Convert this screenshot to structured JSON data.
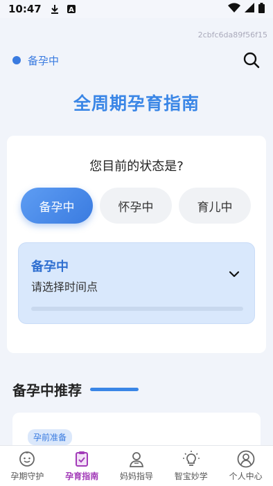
{
  "status_bar": {
    "time": "10:47",
    "icons": [
      "download-icon",
      "notification-a-icon",
      "wifi-icon",
      "signal-icon",
      "battery-icon"
    ]
  },
  "session_id": "2cbfc6da89f56f15",
  "topbar": {
    "state_label": "备孕中",
    "search_icon": "search-icon"
  },
  "hero": {
    "title": "全周期孕育指南"
  },
  "status_card": {
    "question": "您目前的状态是?",
    "options": [
      "备孕中",
      "怀孕中",
      "育儿中"
    ],
    "selected": "备孕中",
    "time_panel": {
      "title": "备孕中",
      "subtitle": "请选择时间点"
    }
  },
  "recommend": {
    "title": "备孕中推荐",
    "first_card_tag": "孕前准备"
  },
  "tabbar": {
    "items": [
      {
        "label": "孕期守护",
        "icon": "smile-face-icon"
      },
      {
        "label": "孕育指南",
        "icon": "checklist-icon"
      },
      {
        "label": "妈妈指导",
        "icon": "mother-icon"
      },
      {
        "label": "智宝妙学",
        "icon": "lightbulb-icon"
      },
      {
        "label": "个人中心",
        "icon": "user-icon"
      }
    ],
    "active_index": 1
  },
  "colors": {
    "accent": "#3a7be0",
    "tab_active": "#a23ab8",
    "panel_bg": "#d9e8fc"
  }
}
